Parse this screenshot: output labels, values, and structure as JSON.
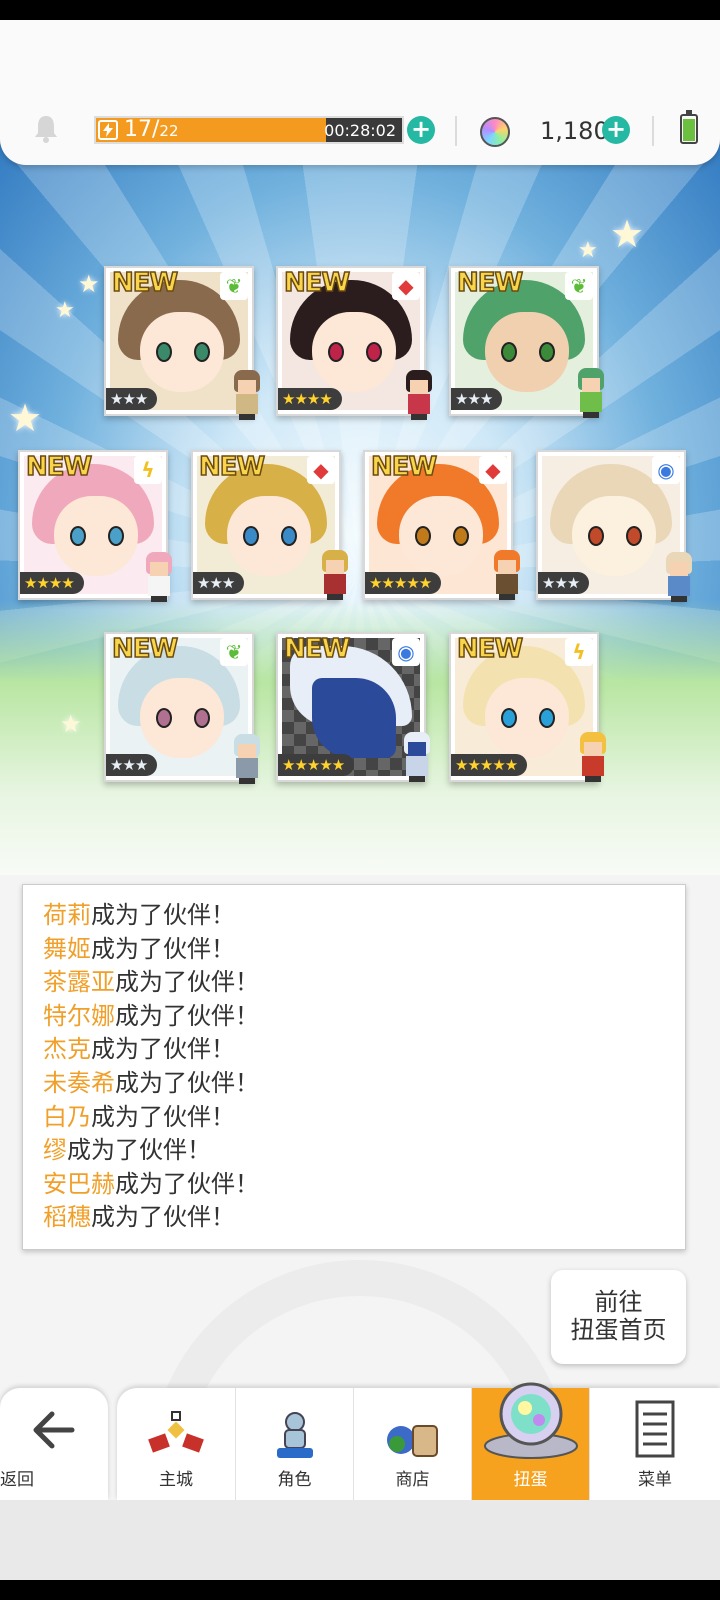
{
  "topbar": {
    "stamina_current": "17",
    "stamina_max": "22",
    "stamina_level": 0.75,
    "stamina_timer": "00:28:02",
    "gem_count": "1,180",
    "icons": [
      "bell-icon",
      "bolt-icon",
      "plus-icon",
      "rainbow-gem-icon",
      "battery-icon"
    ]
  },
  "cards": [
    {
      "new": "NEW",
      "stars": "★★★",
      "element": "wind",
      "rarity": "silver"
    },
    {
      "new": "NEW",
      "stars": "★★★★",
      "element": "fire",
      "rarity": "gold"
    },
    {
      "new": "NEW",
      "stars": "★★★",
      "element": "wind",
      "rarity": "silver"
    },
    {
      "new": "NEW",
      "stars": "★★★★",
      "element": "thunder",
      "rarity": "gold"
    },
    {
      "new": "NEW",
      "stars": "★★★",
      "element": "fire",
      "rarity": "silver"
    },
    {
      "new": "NEW",
      "stars": "★★★★★",
      "element": "fire",
      "rarity": "gold"
    },
    {
      "new": "",
      "stars": "★★★",
      "element": "water",
      "rarity": "silver"
    },
    {
      "new": "NEW",
      "stars": "★★★",
      "element": "wind",
      "rarity": "silver"
    },
    {
      "new": "NEW",
      "stars": "★★★★★",
      "element": "water",
      "rarity": "gold"
    },
    {
      "new": "NEW",
      "stars": "★★★★★",
      "element": "thunder",
      "rarity": "gold"
    }
  ],
  "log": {
    "suffix": "成为了伙伴！",
    "names": [
      "荷莉",
      "舞姬",
      "茶露亚",
      "特尔娜",
      "杰克",
      "未奏希",
      "白乃",
      "缪",
      "安巴赫",
      "稻穗"
    ]
  },
  "goto_button": {
    "line1": "前往",
    "line2": "扭蛋首页"
  },
  "nav": {
    "back": "返回",
    "items": [
      "主城",
      "角色",
      "商店",
      "扭蛋",
      "菜单"
    ],
    "active": "扭蛋"
  },
  "colors": {
    "accent": "#f6a21e",
    "name_highlight": "#f0a02a",
    "plus_button": "#25b9a4"
  }
}
